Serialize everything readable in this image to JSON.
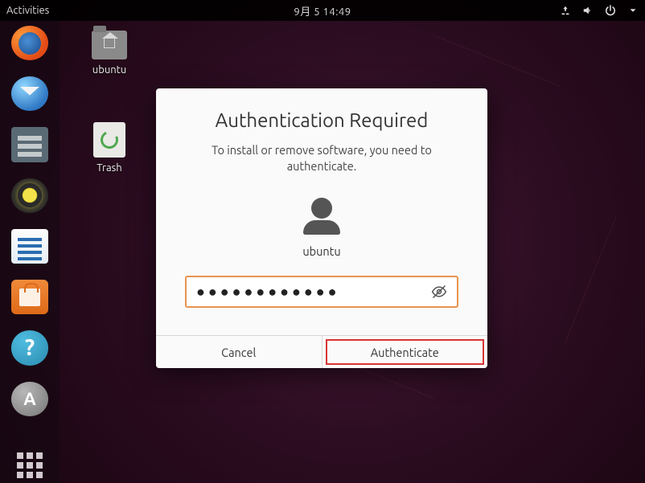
{
  "topbar": {
    "activities": "Activities",
    "datetime": "9月  5   14:49"
  },
  "desktop": {
    "home_label": "ubuntu",
    "trash_label": "Trash"
  },
  "dialog": {
    "title": "Authentication Required",
    "message": "To install or remove software, you need to authenticate.",
    "username": "ubuntu",
    "password_value": "●●●●●●●●●●●●",
    "cancel_label": "Cancel",
    "authenticate_label": "Authenticate"
  }
}
